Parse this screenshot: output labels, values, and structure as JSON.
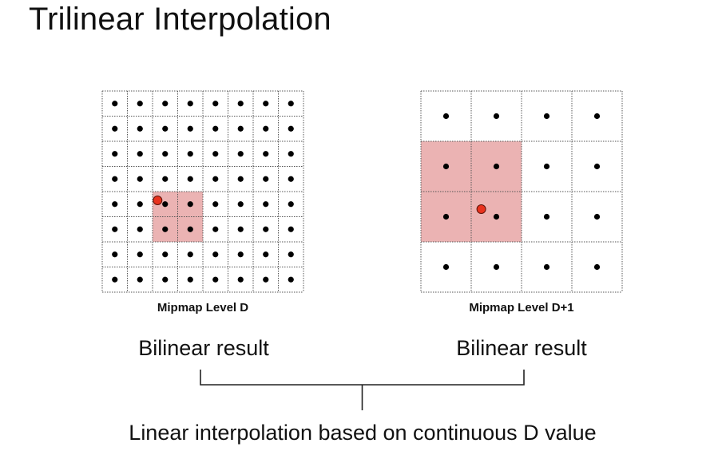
{
  "slide": {
    "title": "Trilinear Interpolation"
  },
  "levels": [
    {
      "caption": "Mipmap Level D",
      "grid_size": 8,
      "highlight": {
        "col_start": 2,
        "row_start": 4,
        "cols": 2,
        "rows": 2
      },
      "sample_point": {
        "col": 2.2,
        "row": 4.35
      }
    },
    {
      "caption": "Mipmap Level D+1",
      "grid_size": 4,
      "highlight": {
        "col_start": 0,
        "row_start": 1,
        "cols": 2,
        "rows": 2
      },
      "sample_point": {
        "col": 1.2,
        "row": 2.35
      }
    }
  ],
  "results": {
    "left": "Bilinear result",
    "right": "Bilinear result"
  },
  "combine_label": "Linear interpolation based on continuous D value",
  "colors": {
    "highlight": "#ebb3b3",
    "sample_point": "#e8321e",
    "texel_dot": "#000000",
    "grid_line": "#555555"
  }
}
